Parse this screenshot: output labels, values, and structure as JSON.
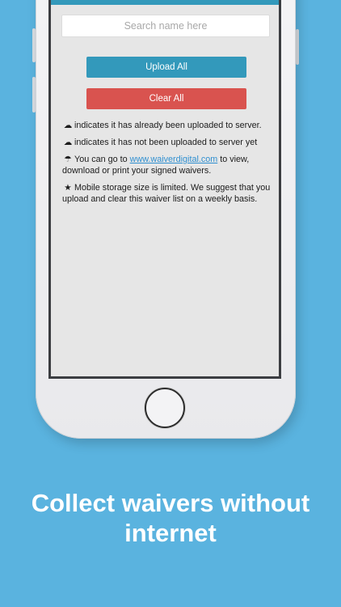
{
  "search": {
    "placeholder": "Search name here"
  },
  "buttons": {
    "upload_all": "Upload All",
    "clear_all": "Clear All"
  },
  "notes": {
    "uploaded": "indicates it has already been uploaded to server.",
    "not_uploaded": "indicates it has not been uploaded to server yet",
    "website_pre": "You can go to",
    "website_link": "www.waiverdigital.com",
    "website_post": "to view, download or print your signed waivers.",
    "storage": "Mobile storage size is limited. We suggest that you upload and clear this waiver list on a weekly basis."
  },
  "icons": {
    "uploaded": "cloud-icon",
    "not_uploaded": "cloud-outline-icon",
    "website": "cloud-rain-icon",
    "storage": "star-icon"
  },
  "colors": {
    "background": "#5ab3df",
    "primary": "#3399bb",
    "danger": "#d9534f",
    "link": "#2f8fd0"
  },
  "headline": "Collect waivers without internet"
}
